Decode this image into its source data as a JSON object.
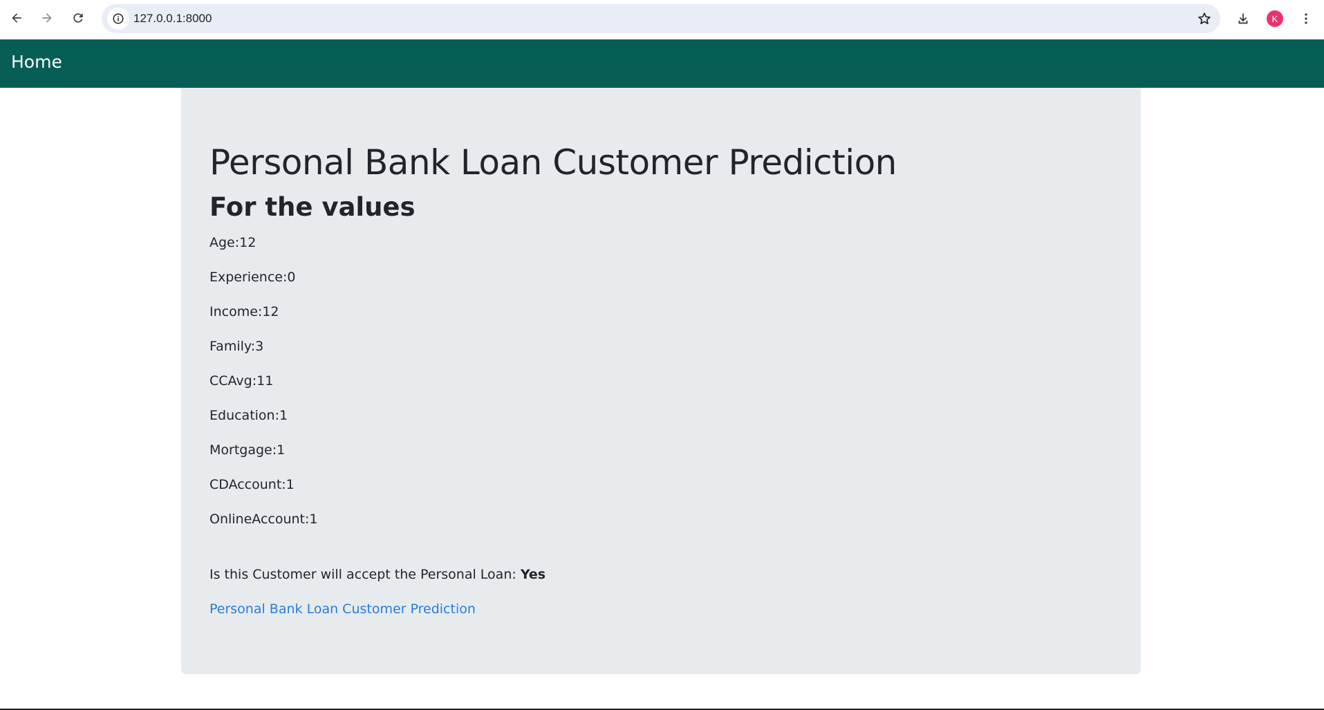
{
  "browser": {
    "url": "127.0.0.1:8000",
    "profile_initial": "K",
    "profile_color": "#e8336d"
  },
  "navbar": {
    "home_label": "Home",
    "background": "#075e54"
  },
  "main": {
    "title": "Personal Bank Loan Customer Prediction",
    "subtitle": "For the values",
    "values": [
      "Age:12",
      "Experience:0",
      "Income:12",
      "Family:3",
      "CCAvg:11",
      "Education:1",
      "Mortgage:1",
      "CDAccount:1",
      "OnlineAccount:1"
    ],
    "result_label": "Is this Customer will accept the Personal Loan: ",
    "result_value": "Yes",
    "link_label": "Personal Bank Loan Customer Prediction"
  }
}
